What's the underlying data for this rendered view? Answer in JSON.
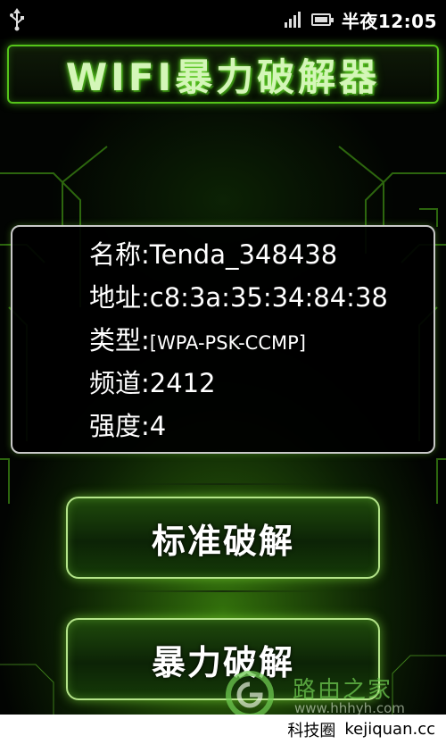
{
  "status_bar": {
    "time": "半夜12:05",
    "icons": [
      "usb-icon",
      "signal-icon",
      "battery-icon"
    ]
  },
  "app": {
    "title": "WIFI暴力破解器"
  },
  "network_info": {
    "name_label": "名称:",
    "name_value": "Tenda_348438",
    "address_label": "地址:",
    "address_value": "c8:3a:35:34:84:38",
    "type_label": "类型:",
    "type_value": "[WPA-PSK-CCMP]",
    "channel_label": "频道:",
    "channel_value": "2412",
    "strength_label": "强度:",
    "strength_value": "4"
  },
  "buttons": {
    "standard_crack": "标准破解",
    "brute_force_crack": "暴力破解"
  },
  "watermark": {
    "site_name": "路由之家",
    "site_url": "www.hhhyh.com",
    "bottom_name": "科技圈",
    "bottom_url": "kejiquan.cc"
  },
  "colors": {
    "accent_green": "#55c41a",
    "panel_border": "#c9c9c9",
    "button_border": "#b4e48a"
  }
}
